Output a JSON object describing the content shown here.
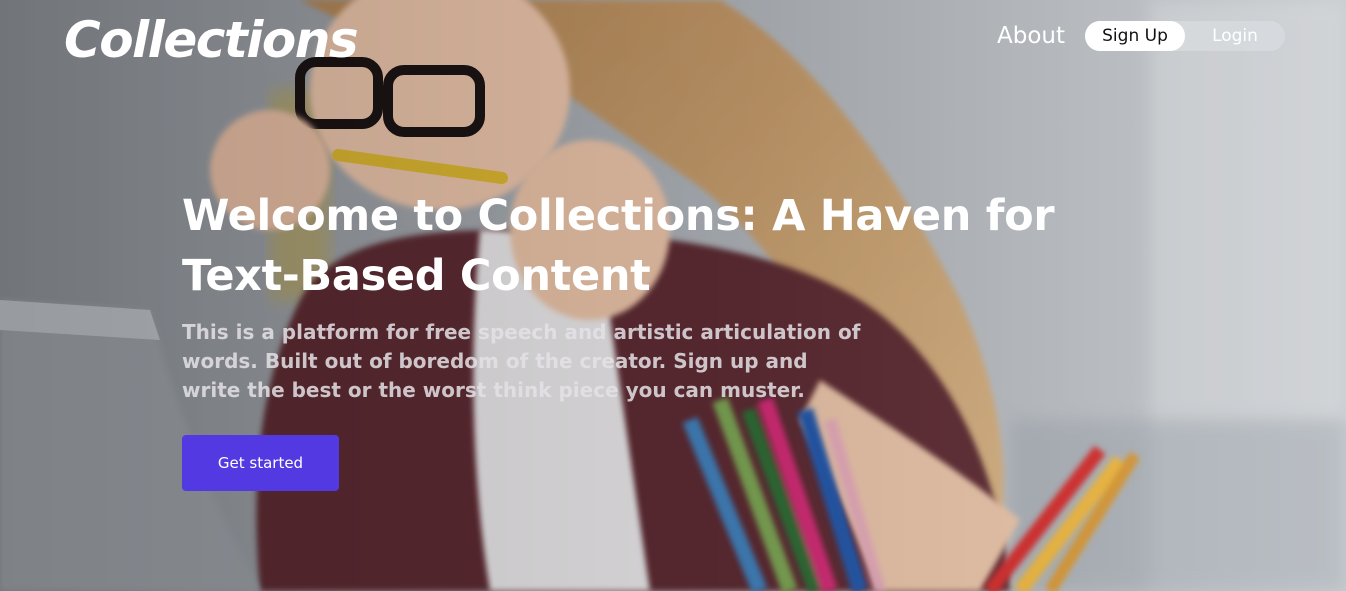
{
  "header": {
    "brand": "Collections",
    "nav_about": "About",
    "signup_label": "Sign Up",
    "login_label": "Login"
  },
  "hero": {
    "headline": "Welcome to Collections: A Haven for Text-Based Content",
    "subtext": "This is a platform for free speech and artistic articulation of words. Built out of boredom of the creator. Sign up and write the best or the worst think piece you can muster.",
    "cta_label": "Get started"
  },
  "colors": {
    "cta_background": "#5339e2",
    "toggle_active": "#ffffff",
    "text_primary": "#ffffff"
  }
}
